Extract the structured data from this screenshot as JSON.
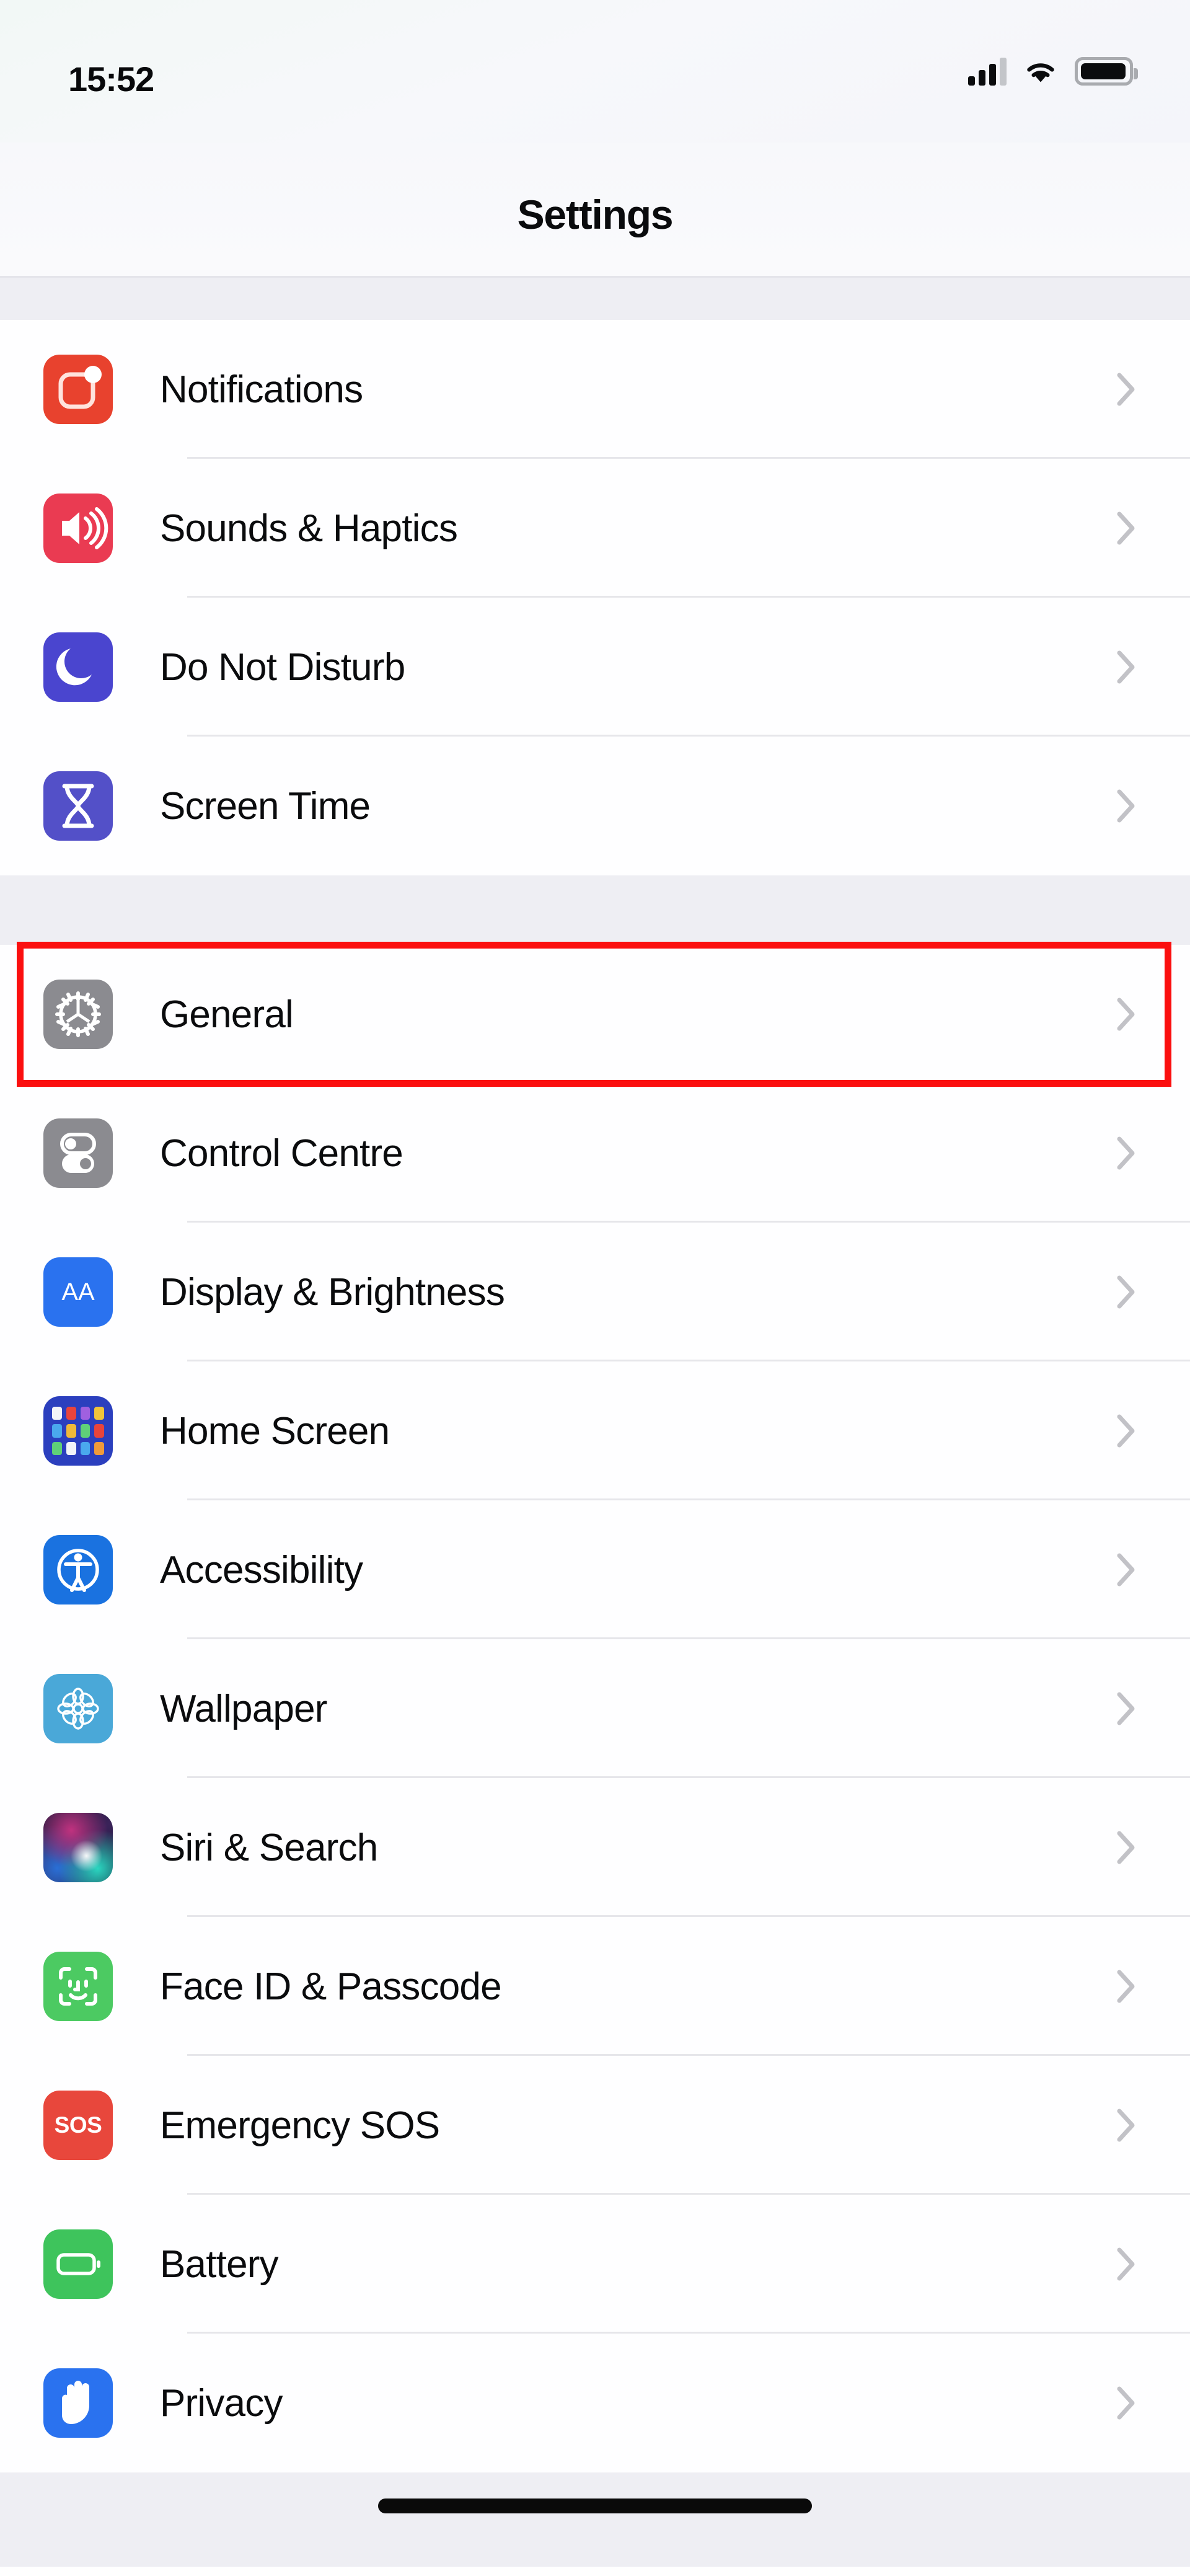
{
  "status_bar": {
    "time": "15:52",
    "signal_icon": "cellular-signal-icon",
    "signal_bars_filled": 3,
    "signal_bars_total": 4,
    "wifi_icon": "wifi-icon",
    "battery_icon": "battery-icon",
    "battery_level_percent": 85
  },
  "header": {
    "title": "Settings"
  },
  "highlight": {
    "target_row": "General",
    "color": "#fb0f0f",
    "border_width_px": 11
  },
  "colors": {
    "page_background": "#fefeff",
    "group_gap": "#eeeef3",
    "separator": "#e6e6ea",
    "label_text": "#0a0b0d",
    "chevron": "#c2c2c7",
    "highlight_red": "#fb0f0f"
  },
  "groups": [
    {
      "id": "group-1",
      "rows": [
        {
          "label": "Notifications",
          "icon": "notifications-icon",
          "icon_color": "#e8422e",
          "chevron": "chevron-right-icon",
          "highlighted": false
        },
        {
          "label": "Sounds & Haptics",
          "icon": "sounds-haptics-icon",
          "icon_color": "#ea3b52",
          "chevron": "chevron-right-icon",
          "highlighted": false
        },
        {
          "label": "Do Not Disturb",
          "icon": "do-not-disturb-icon",
          "icon_color": "#4a45cf",
          "chevron": "chevron-right-icon",
          "highlighted": false
        },
        {
          "label": "Screen Time",
          "icon": "screen-time-icon",
          "icon_color": "#5350c8",
          "chevron": "chevron-right-icon",
          "highlighted": false
        }
      ]
    },
    {
      "id": "group-2",
      "rows": [
        {
          "label": "General",
          "icon": "gear-icon",
          "icon_color": "#8b8b90",
          "chevron": "chevron-right-icon",
          "highlighted": true
        },
        {
          "label": "Control Centre",
          "icon": "control-centre-icon",
          "icon_color": "#8b8b90",
          "chevron": "chevron-right-icon",
          "highlighted": false
        },
        {
          "label": "Display & Brightness",
          "icon": "display-brightness-icon",
          "icon_color": "#2a72ef",
          "chevron": "chevron-right-icon",
          "highlighted": false
        },
        {
          "label": "Home Screen",
          "icon": "home-screen-icon",
          "icon_color": "#2b3fbe",
          "chevron": "chevron-right-icon",
          "highlighted": false
        },
        {
          "label": "Accessibility",
          "icon": "accessibility-icon",
          "icon_color": "#1a72e0",
          "chevron": "chevron-right-icon",
          "highlighted": false
        },
        {
          "label": "Wallpaper",
          "icon": "wallpaper-icon",
          "icon_color": "#4aa8d8",
          "chevron": "chevron-right-icon",
          "highlighted": false
        },
        {
          "label": "Siri & Search",
          "icon": "siri-icon",
          "icon_color": "#3a2259",
          "chevron": "chevron-right-icon",
          "highlighted": false
        },
        {
          "label": "Face ID & Passcode",
          "icon": "face-id-icon",
          "icon_color": "#4cca62",
          "chevron": "chevron-right-icon",
          "highlighted": false
        },
        {
          "label": "Emergency SOS",
          "icon": "sos-icon",
          "icon_color": "#e8473c",
          "chevron": "chevron-right-icon",
          "highlighted": false
        },
        {
          "label": "Battery",
          "icon": "battery-settings-icon",
          "icon_color": "#3ec45c",
          "chevron": "chevron-right-icon",
          "highlighted": false
        },
        {
          "label": "Privacy",
          "icon": "privacy-hand-icon",
          "icon_color": "#2a72ef",
          "chevron": "chevron-right-icon",
          "highlighted": false
        }
      ]
    }
  ],
  "home_indicator": {
    "icon": "home-indicator-bar"
  }
}
